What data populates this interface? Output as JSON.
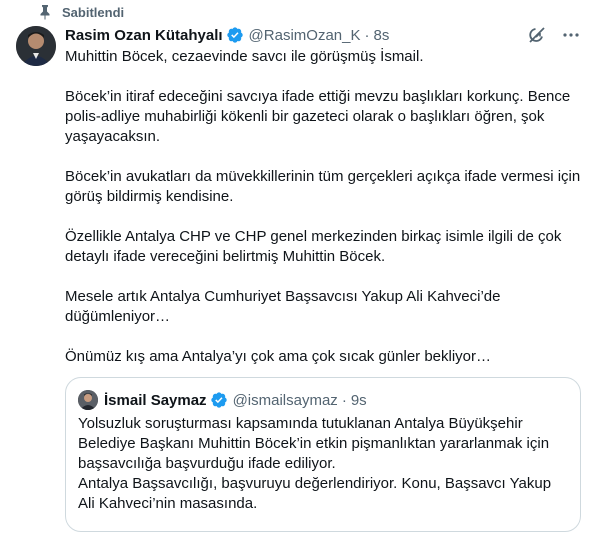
{
  "pinned_label": "Sabitlendi",
  "tweet": {
    "display_name": "Rasim Ozan Kütahyalı",
    "handle": "@RasimOzan_K",
    "separator": "·",
    "time": "8s",
    "paragraphs": [
      "Muhittin Böcek, cezaevinde savcı ile görüşmüş İsmail.",
      "Böcek’in itiraf edeceğini savcıya ifade ettiği mevzu başlıkları korkunç. Bence polis-adliye muhabirliği kökenli bir gazeteci olarak o başlıkları öğren, şok yaşayacaksın.",
      "Böcek’in avukatları da müvekkillerinin tüm gerçekleri açıkça ifade vermesi için görüş bildirmiş kendisine.",
      "Özellikle Antalya CHP ve CHP genel merkezinden birkaç isimle ilgili de çok detaylı ifade vereceğini belirtmiş Muhittin Böcek.",
      "Mesele artık Antalya Cumhuriyet Başsavcısı Yakup Ali Kahveci’de düğümleniyor…",
      "Önümüz kış ama Antalya’yı çok ama çok sıcak günler bekliyor…"
    ]
  },
  "quote": {
    "display_name": "İsmail Saymaz",
    "handle": "@ismailsaymaz",
    "separator": "·",
    "time": "9s",
    "lines": [
      "Yolsuzluk soruşturması kapsamında tutuklanan Antalya Büyükşehir Belediye Başkanı Muhittin Böcek’in etkin pişmanlıktan yararlanmak için başsavcılığa başvurduğu ifade ediliyor.",
      "Antalya Başsavcılığı, başvuruyu değerlendiriyor. Konu, Başsavcı Yakup Ali Kahveci’nin masasında."
    ]
  },
  "icons": {
    "pin": "pin-icon",
    "verified": "verified-badge-icon",
    "grok": "grok-icon",
    "more": "more-icon"
  },
  "colors": {
    "text": "#0f1419",
    "secondary": "#536471",
    "verified": "#1d9bf0",
    "border": "#cfd9de"
  }
}
